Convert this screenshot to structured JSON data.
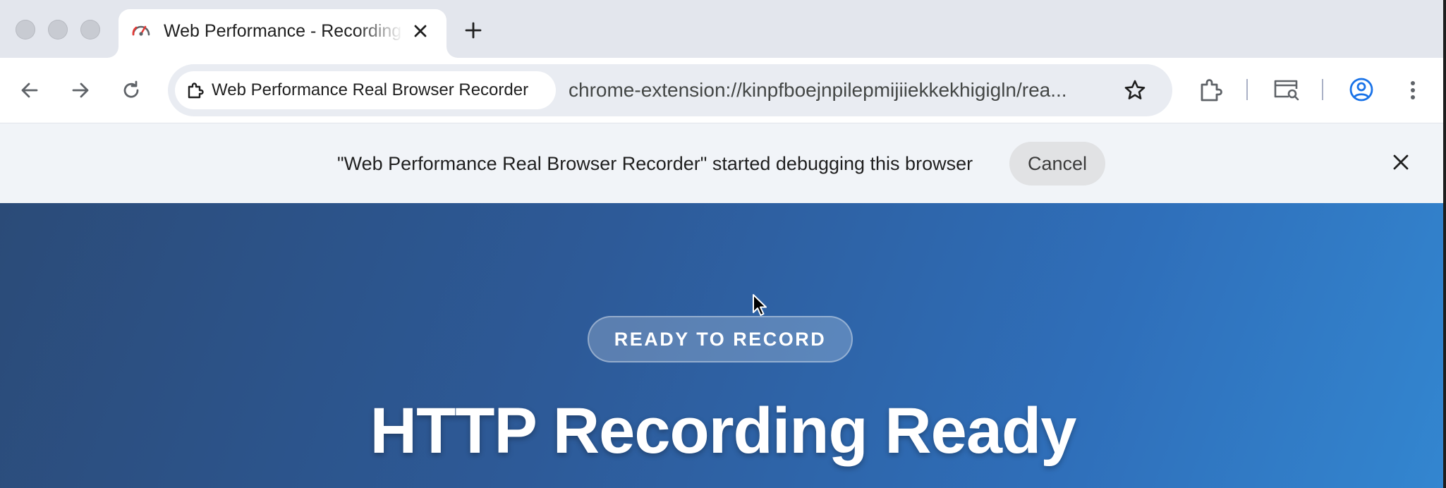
{
  "colors": {
    "tabstrip_bg": "#e3e6ed",
    "omnibox_bg": "#e9ecf2",
    "infobar_bg": "#f1f4f8",
    "content_gradient_start": "#2b4b78",
    "content_gradient_end": "#3386d0",
    "toolbar_icon": "#5f6368",
    "profile_accent": "#1a73e8",
    "favicon_accent": "#e53935"
  },
  "window": {
    "traffic_lights": [
      "close-button",
      "minimize-button",
      "zoom-button"
    ]
  },
  "tabs": [
    {
      "title": "Web Performance - Recording",
      "favicon": "speedometer-icon",
      "active": true,
      "close_icon": "close-icon"
    }
  ],
  "new_tab_icon": "plus-icon",
  "toolbar": {
    "back_icon": "arrow-left-icon",
    "forward_icon": "arrow-right-icon",
    "reload_icon": "reload-icon",
    "site_chip": {
      "icon": "puzzle-piece-icon",
      "label": "Web Performance Real Browser Recorder"
    },
    "url": "chrome-extension://kinpfboejnpilepmijiiekkekhigigln/rea...",
    "bookmark_icon": "star-icon",
    "extensions_icon": "puzzle-piece-icon",
    "tab_search_icon": "tab-search-icon",
    "profile_icon": "account-circle-icon",
    "menu_icon": "more-vertical-icon"
  },
  "infobar": {
    "message": "\"Web Performance Real Browser Recorder\" started debugging this browser",
    "cancel_label": "Cancel",
    "close_icon": "close-icon"
  },
  "page": {
    "status_pill": "READY TO RECORD",
    "title": "HTTP Recording Ready"
  }
}
